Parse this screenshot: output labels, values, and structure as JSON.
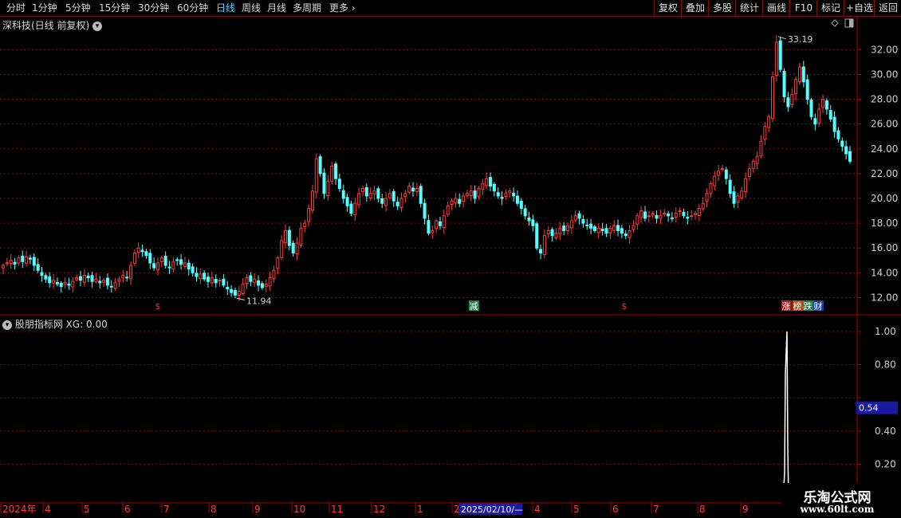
{
  "toolbar": {
    "periods": [
      "分时",
      "1分钟",
      "5分钟",
      "15分钟",
      "30分钟",
      "60分钟",
      "日线",
      "周线",
      "月线",
      "多周期",
      "更多"
    ],
    "active_index": 6,
    "more_arrow": "›",
    "right_buttons": [
      "复权",
      "叠加",
      "多股",
      "统计",
      "画线",
      "F10",
      "标记",
      "+自选",
      "返回"
    ]
  },
  "main_panel": {
    "title": "深科技(日线 前复权)",
    "y_labels": [
      "32.00",
      "30.00",
      "28.00",
      "26.00",
      "24.00",
      "22.00",
      "20.00",
      "18.00",
      "16.00",
      "14.00",
      "12.00"
    ],
    "high_label": "33.19",
    "low_label": "11.94",
    "markers": [
      {
        "text": "$",
        "color": "#ff3030",
        "bg": ""
      },
      {
        "text": "减",
        "color": "#ffffff",
        "bg": "#208040"
      },
      {
        "text": "$",
        "color": "#ff3030",
        "bg": ""
      },
      {
        "text": "涨",
        "color": "#ffffff",
        "bg": "#a02020"
      },
      {
        "text": "榜",
        "color": "#ffffff",
        "bg": "#b05010"
      },
      {
        "text": "跌",
        "color": "#ffffff",
        "bg": "#208040"
      },
      {
        "text": "财",
        "color": "#ffffff",
        "bg": "#2040a0"
      }
    ],
    "icons": [
      "diamond-icon",
      "panel-toggle-icon"
    ]
  },
  "indicator_panel": {
    "title": "股朋指标网",
    "value_label": "XG: 0.00",
    "y_labels": [
      "1.00",
      "0.80",
      "0.40",
      "0.20"
    ],
    "cursor_value": "0.54"
  },
  "date_axis": {
    "labels": [
      "2024年",
      "4",
      "5",
      "6",
      "7",
      "8",
      "9",
      "10",
      "11",
      "12",
      "1",
      "2",
      "4",
      "5",
      "6",
      "7",
      "8",
      "9"
    ],
    "cursor_label": "2025/02/10/—"
  },
  "watermark": {
    "title": "乐淘公式网",
    "url": "www.60lt.com"
  },
  "colors": {
    "up": "#ff3c3c",
    "down": "#54ffff",
    "grid": "#7a1010",
    "axis": "#b00000",
    "bg": "#000000",
    "accent": "#5ad8ff",
    "cursor": "#1a1aa0"
  },
  "chart_data": {
    "type": "candlestick",
    "ylim": [
      11,
      33.5
    ],
    "high": 33.19,
    "low": 11.94,
    "closes": [
      14.6,
      14.8,
      15.0,
      14.7,
      15.2,
      14.9,
      15.3,
      15.1,
      14.6,
      14.2,
      13.8,
      13.5,
      13.2,
      13.4,
      13.1,
      12.9,
      13.2,
      13.0,
      13.3,
      13.6,
      13.4,
      13.8,
      13.6,
      13.3,
      13.5,
      13.2,
      13.4,
      13.0,
      12.9,
      13.2,
      13.5,
      13.8,
      13.6,
      14.6,
      15.6,
      16.0,
      15.7,
      15.4,
      14.8,
      14.4,
      14.8,
      15.2,
      14.6,
      14.4,
      14.9,
      15.0,
      14.7,
      14.8,
      14.3,
      14.0,
      13.7,
      13.9,
      13.5,
      13.3,
      13.6,
      13.2,
      13.4,
      13.0,
      12.7,
      12.4,
      12.2,
      12.5,
      13.1,
      13.6,
      13.3,
      13.5,
      13.0,
      12.8,
      13.1,
      13.6,
      14.2,
      15.2,
      16.6,
      17.4,
      16.2,
      15.6,
      16.4,
      17.6,
      18.0,
      19.2,
      20.6,
      23.2,
      22.0,
      20.4,
      21.4,
      22.6,
      21.6,
      20.8,
      20.0,
      19.4,
      18.8,
      19.6,
      20.4,
      20.8,
      20.2,
      20.4,
      20.6,
      20.0,
      19.6,
      20.0,
      20.4,
      19.8,
      19.4,
      20.0,
      20.4,
      21.0,
      20.6,
      20.8,
      19.6,
      18.4,
      17.2,
      17.4,
      18.2,
      17.8,
      18.6,
      19.4,
      19.8,
      20.0,
      19.6,
      20.2,
      20.4,
      20.6,
      20.0,
      20.8,
      21.2,
      21.6,
      21.0,
      20.6,
      20.2,
      20.0,
      20.4,
      20.6,
      20.2,
      19.6,
      19.2,
      18.6,
      18.2,
      17.8,
      16.0,
      15.6,
      17.0,
      17.4,
      17.0,
      17.2,
      17.6,
      17.4,
      17.8,
      18.2,
      18.6,
      18.4,
      18.0,
      17.8,
      17.6,
      17.4,
      17.6,
      17.4,
      17.2,
      17.6,
      17.8,
      17.4,
      17.2,
      17.0,
      17.4,
      17.8,
      18.6,
      19.0,
      18.4,
      18.6,
      18.8,
      18.4,
      18.6,
      18.8,
      18.6,
      18.4,
      18.8,
      19.0,
      18.6,
      18.4,
      18.6,
      18.8,
      19.2,
      19.6,
      20.4,
      21.2,
      21.8,
      22.2,
      22.4,
      21.6,
      20.4,
      19.6,
      20.2,
      20.6,
      21.6,
      22.4,
      23.0,
      23.4,
      24.6,
      25.8,
      26.6,
      29.8,
      32.6,
      30.4,
      28.2,
      27.4,
      28.4,
      29.6,
      30.6,
      29.4,
      28.0,
      26.6,
      26.0,
      27.2,
      28.0,
      27.2,
      26.4,
      25.4,
      24.8,
      24.2,
      23.6,
      23.0
    ]
  }
}
